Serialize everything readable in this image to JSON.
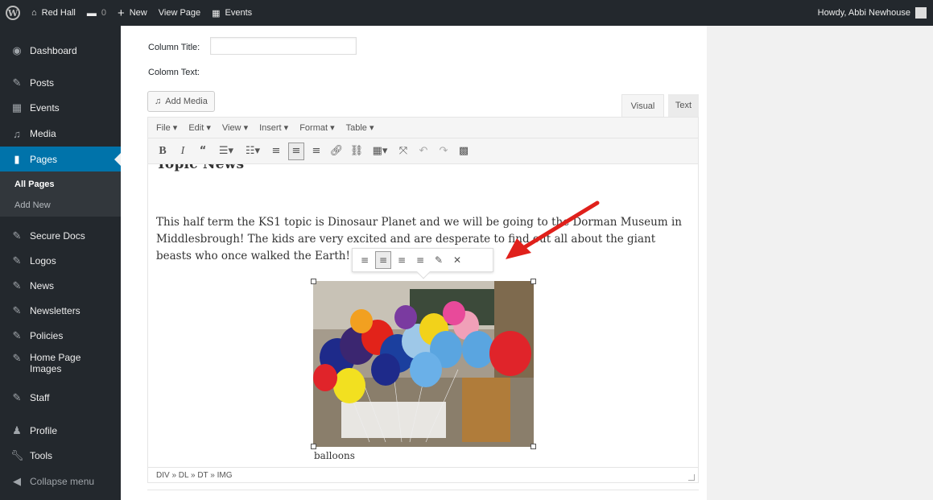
{
  "admin_bar": {
    "site_name": "Red Hall",
    "comments_count": "0",
    "new_label": "New",
    "view_page_label": "View Page",
    "events_label": "Events",
    "howdy": "Howdy, Abbi Newhouse"
  },
  "sidebar": {
    "dashboard": "Dashboard",
    "posts": "Posts",
    "events": "Events",
    "media": "Media",
    "pages": "Pages",
    "all_pages": "All Pages",
    "add_new": "Add New",
    "secure_docs": "Secure Docs",
    "logos": "Logos",
    "news": "News",
    "newsletters": "Newsletters",
    "policies": "Policies",
    "home_page_images": "Home Page Images",
    "staff": "Staff",
    "profile": "Profile",
    "tools": "Tools",
    "collapse": "Collapse menu"
  },
  "form": {
    "column_title_label": "Column Title:",
    "column_title_value": "",
    "column_text_label": "Colomn Text:",
    "add_media": "Add Media",
    "tab_visual": "Visual",
    "tab_text": "Text"
  },
  "editor": {
    "menus": [
      "File",
      "Edit",
      "View",
      "Insert",
      "Format",
      "Table"
    ],
    "heading_partial": "Topic News",
    "paragraph": "This half term the KS1 topic is Dinosaur Planet and we will be going to the Dorman Museum in Middlesbrough! The kids are very excited and are desperate to find out all about the giant beasts who once walked the Earth!",
    "caption": "balloons",
    "statusbar_path": "DIV » DL » DT » IMG"
  },
  "colors": {
    "admin_dark": "#23282d",
    "accent_blue": "#0073aa",
    "annotation_red": "#e0201b"
  }
}
